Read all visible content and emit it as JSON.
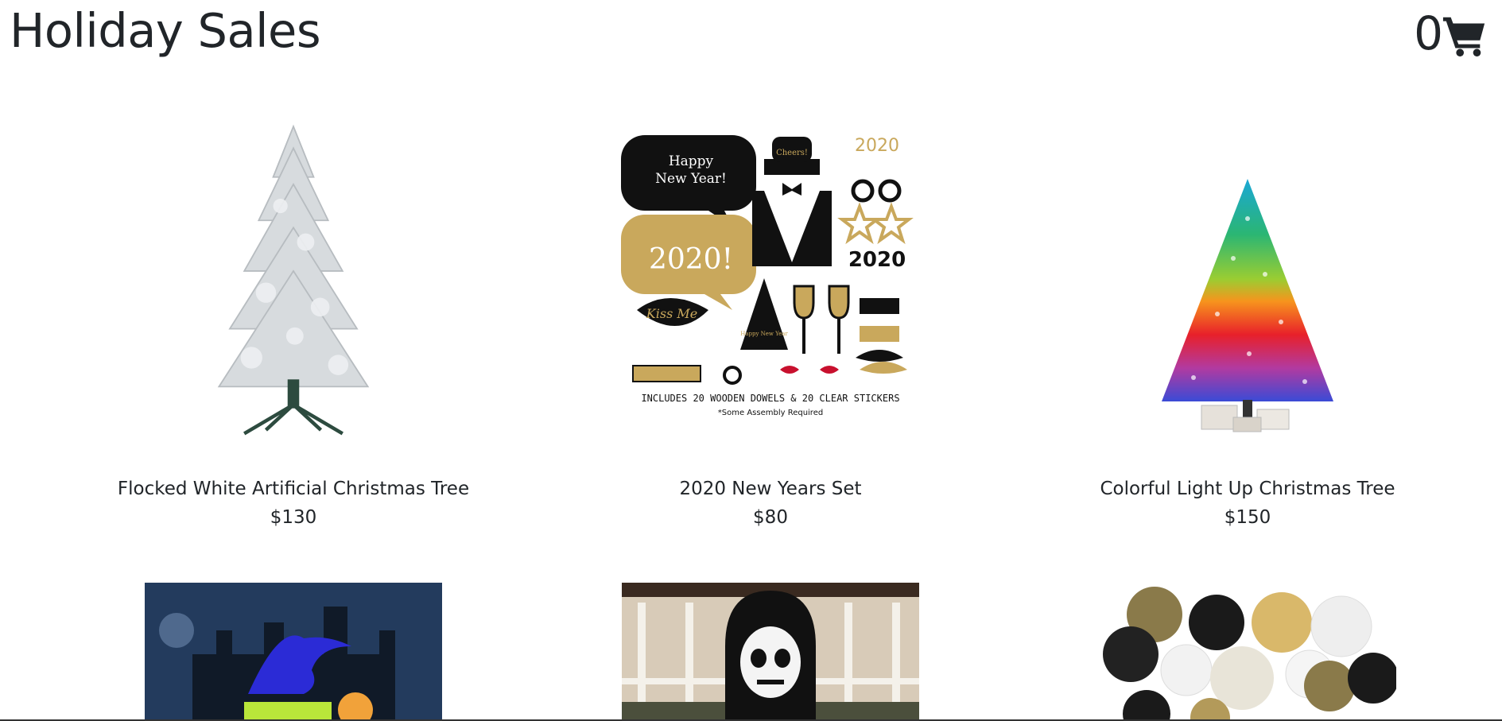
{
  "header": {
    "title": "Holiday Sales",
    "cart_count": "0",
    "cart_icon": "shopping-cart-icon"
  },
  "products": [
    {
      "name": "Flocked White Artificial Christmas Tree",
      "price": "$130"
    },
    {
      "name": "2020 New Years Set",
      "price": "$80",
      "image_text": {
        "bubble1_line1": "Happy",
        "bubble1_line2": "New Year!",
        "bubble2": "2020!",
        "glasses": "2020",
        "glasses2": "2020",
        "hat": "Cheers!",
        "lips": "Kiss Me",
        "party_hat": "Happy New Year",
        "caption": "INCLUDES 20 WOODEN DOWELS & 20 CLEAR STICKERS",
        "sub_caption": "*Some Assembly Required"
      }
    },
    {
      "name": "Colorful Light Up Christmas Tree",
      "price": "$150"
    },
    {
      "name": "",
      "price": ""
    },
    {
      "name": "",
      "price": ""
    },
    {
      "name": "",
      "price": ""
    }
  ],
  "colors": {
    "text": "#212529",
    "gold": "#c9a85c",
    "flock": "#d9dde0"
  }
}
